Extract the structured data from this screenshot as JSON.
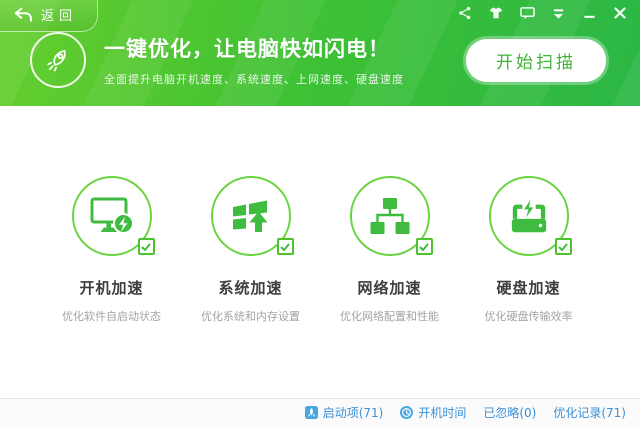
{
  "titlebar": {
    "back_label": "返回",
    "icons": [
      "share-icon",
      "skin-icon",
      "feedback-icon",
      "menu-icon",
      "minimize-icon",
      "close-icon"
    ]
  },
  "banner": {
    "title": "一键优化，让电脑快如闪电！",
    "subtitle": "全面提升电脑开机速度、系统速度、上网速度、硬盘速度",
    "scan_button_label": "开始扫描"
  },
  "features": [
    {
      "label": "开机加速",
      "desc": "优化软件自启动状态",
      "icon": "monitor-bolt-icon",
      "checked": true
    },
    {
      "label": "系统加速",
      "desc": "优化系统和内存设置",
      "icon": "windows-up-icon",
      "checked": true
    },
    {
      "label": "网络加速",
      "desc": "优化网络配置和性能",
      "icon": "network-nodes-icon",
      "checked": true
    },
    {
      "label": "硬盘加速",
      "desc": "优化硬盘传输效率",
      "icon": "disk-bolt-icon",
      "checked": true
    }
  ],
  "statusbar": {
    "items": [
      {
        "label": "启动项(71)",
        "icon": "rocket-badge-icon"
      },
      {
        "label": "开机时间",
        "icon": "clock-badge-icon"
      },
      {
        "label": "已忽略(0)",
        "icon": null
      },
      {
        "label": "优化记录(71)",
        "icon": null
      }
    ]
  },
  "colors": {
    "header_green_light": "#66ce2e",
    "header_green_dark": "#2cb747",
    "accent_green": "#3fbc3f",
    "circle_ring_green": "#68d43d",
    "scan_text_green": "#3cb434",
    "link_blue": "#3a8fd8",
    "badge_blue": "#4aa6e0",
    "label_dark": "#3d3d3d",
    "desc_gray": "#a3a3a3"
  }
}
